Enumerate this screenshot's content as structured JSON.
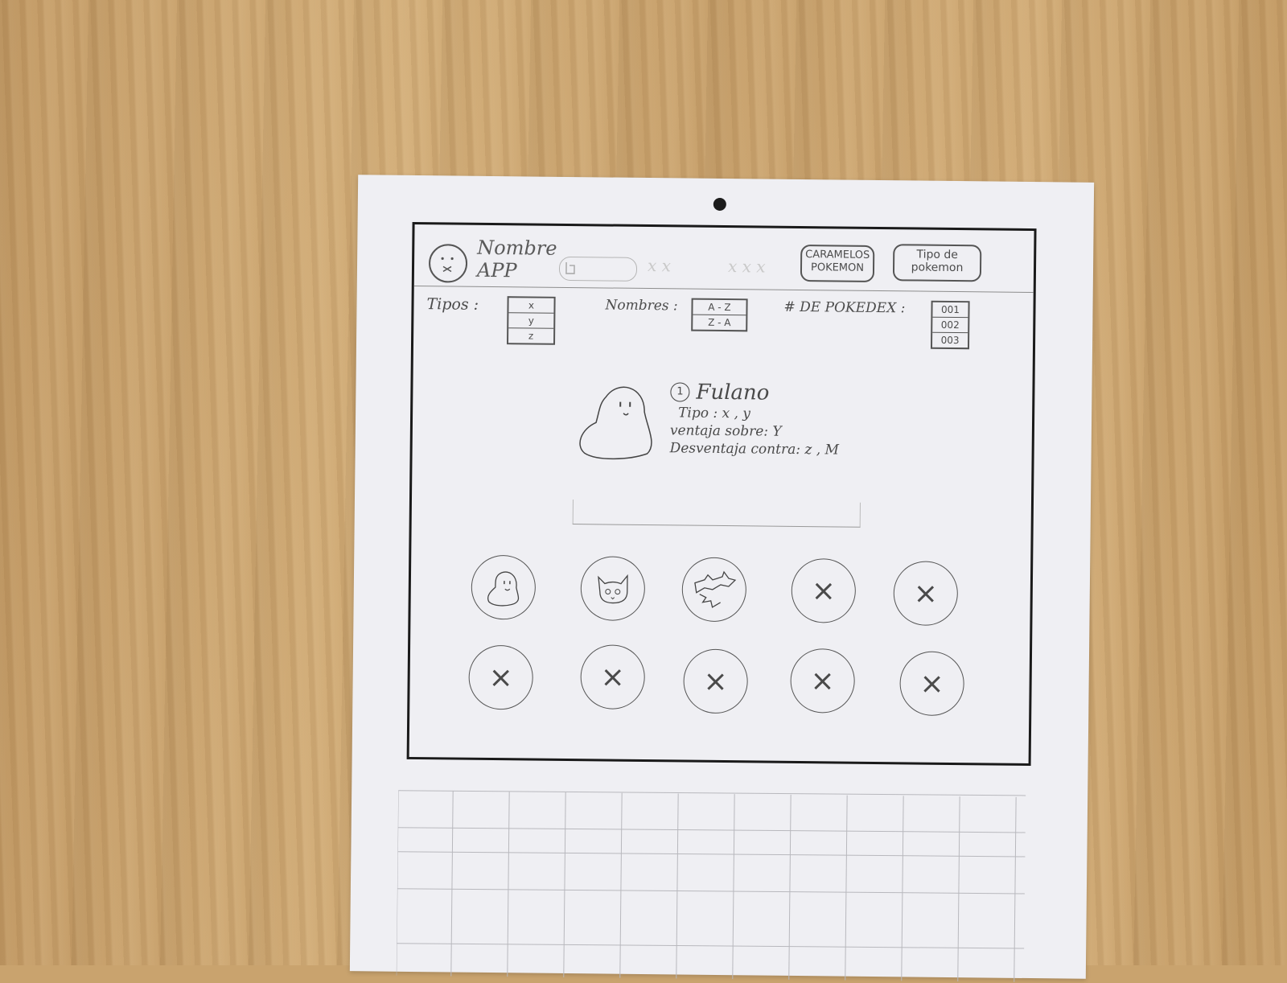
{
  "header": {
    "app_name_line1": "Nombre",
    "app_name_line2": "APP",
    "faint_text_1": "x x",
    "faint_text_2": "x x x",
    "button_caramelos": "CARAMELOS POKEMON",
    "button_tipo": "Tipo de pokemon"
  },
  "filters": {
    "tipos_label": "Tipos :",
    "tipos_options": [
      "x",
      "y",
      "z"
    ],
    "nombres_label": "Nombres :",
    "nombres_options": [
      "A - Z",
      "Z - A"
    ],
    "pokedex_label": "# DE POKEDEX :",
    "pokedex_options": [
      "001",
      "002",
      "003"
    ]
  },
  "detail": {
    "number": "1",
    "name": "Fulano",
    "tipo": "Tipo :  x , y",
    "ventaja": "ventaja sobre:  Y",
    "desventaja": "Desventaja contra:  z , M"
  },
  "grid": {
    "row1": [
      "ghost",
      "cat",
      "dragon",
      "×",
      "×"
    ],
    "row2": [
      "×",
      "×",
      "×",
      "×",
      "×"
    ]
  },
  "colors": {
    "paper": "#efeff3",
    "ink": "#1a1a1a",
    "pencil": "#4a4a4a"
  }
}
